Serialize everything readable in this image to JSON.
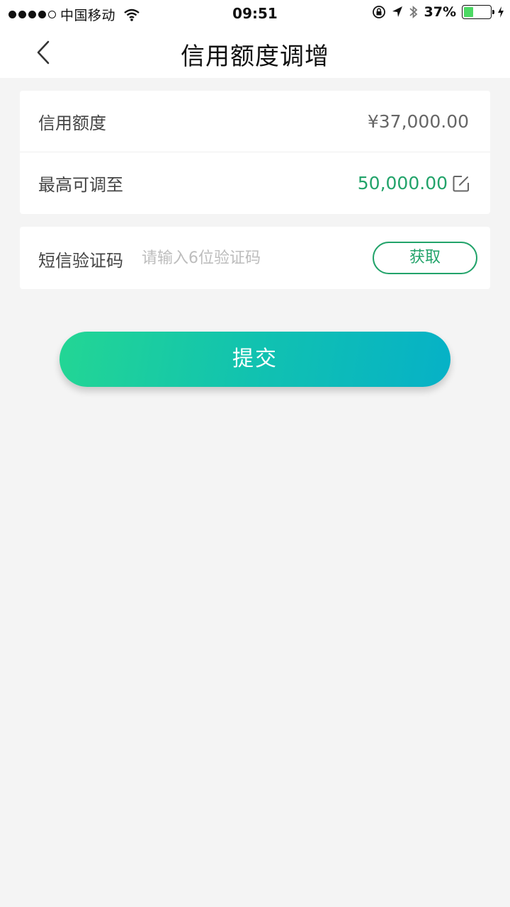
{
  "status_bar": {
    "carrier": "中国移动",
    "time": "09:51",
    "battery": "37%",
    "battery_level": 0.37,
    "icons": [
      "signal-dots-icon",
      "wifi-icon",
      "orientation-lock-icon",
      "location-arrow-icon",
      "bluetooth-icon",
      "battery-icon",
      "charging-bolt-icon"
    ]
  },
  "nav": {
    "title": "信用额度调增",
    "back_icon": "chevron-left-icon"
  },
  "limits": {
    "credit_label": "信用额度",
    "credit_value": "¥37,000.00",
    "max_label": "最高可调至",
    "max_value": "50,000.00",
    "edit_icon": "edit-icon"
  },
  "sms": {
    "label": "短信验证码",
    "placeholder": "请输入6位验证码",
    "value": "",
    "get_code": "获取"
  },
  "submit": {
    "label": "提交"
  },
  "colors": {
    "accent": "#22a36a",
    "gradient_start": "#23d694",
    "gradient_end": "#06b1c7",
    "background": "#f4f4f4"
  }
}
